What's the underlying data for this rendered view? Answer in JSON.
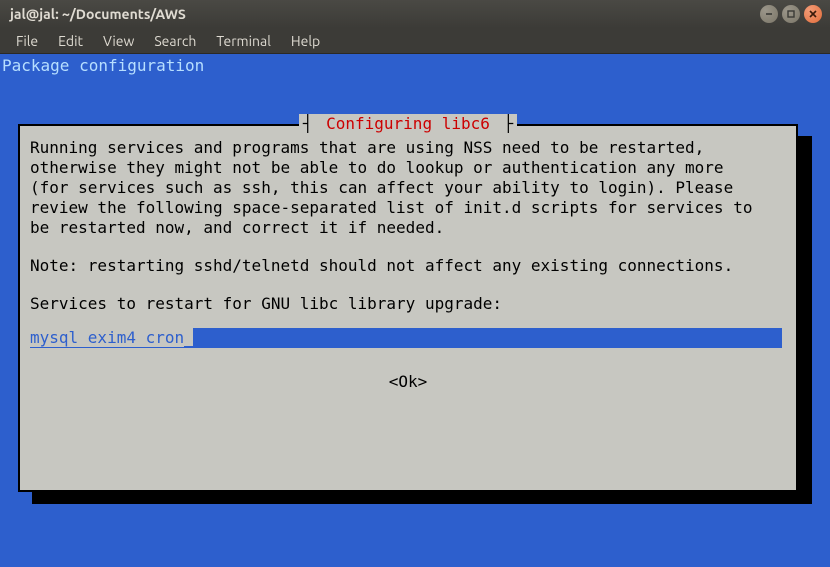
{
  "window": {
    "title": "jal@jal: ~/Documents/AWS"
  },
  "menubar": {
    "items": [
      "File",
      "Edit",
      "View",
      "Search",
      "Terminal",
      "Help"
    ]
  },
  "terminal": {
    "header": "Package configuration",
    "dialog": {
      "title": "Configuring libc6",
      "frame_left": "┤",
      "frame_right": "├",
      "body": "Running services and programs that are using NSS need to be restarted,\notherwise they might not be able to do lookup or authentication any more\n(for services such as ssh, this can affect your ability to login). Please\nreview the following space-separated list of init.d scripts for services to\nbe restarted now, and correct it if needed.",
      "note": "Note: restarting sshd/telnetd should not affect any existing connections.",
      "prompt": "Services to restart for GNU libc library upgrade:",
      "input_value": "mysql exim4 cron",
      "ok_label": "<Ok>"
    }
  }
}
